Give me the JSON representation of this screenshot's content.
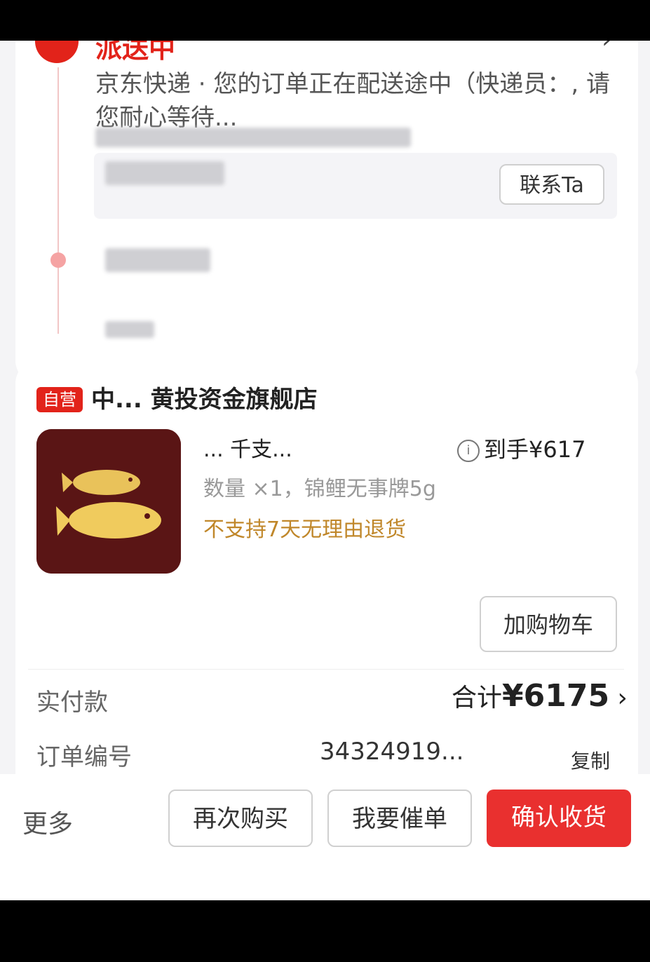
{
  "colors": {
    "accent": "#e2231a",
    "return_note": "#c0872a",
    "confirm_bg": "#e9302f"
  },
  "status": {
    "title": "派送中"
  },
  "delivery": {
    "message": "京东快递 · 您的订单正在配送途中（快递员：, 请您耐心等待...",
    "contact_label": "联系Ta"
  },
  "store": {
    "badge": "自营",
    "name": "中... 黄投资金旗舰店"
  },
  "product": {
    "title_fragment": "... 千支...",
    "price_prefix": "到手¥617",
    "qty_spec": "数量 ×1，锦鲤无事牌5g",
    "return_note": "不支持7天无理由退货",
    "add_to_cart": "加购物车"
  },
  "payment": {
    "paid_label": "实付款",
    "total_prefix": "合计",
    "total_amount": "¥6175",
    "chevron": "›"
  },
  "order": {
    "number_label": "订单编号",
    "number_value": "34324919...",
    "copy_label": "复制"
  },
  "actions": {
    "more": "更多",
    "buy_again": "再次购买",
    "urge": "我要催单",
    "confirm": "确认收货"
  }
}
